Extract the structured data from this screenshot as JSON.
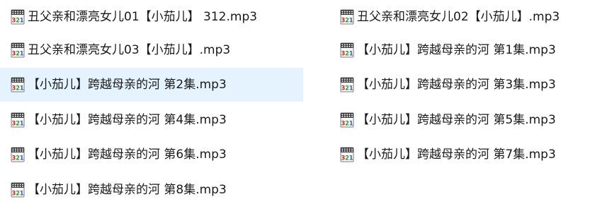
{
  "files": [
    {
      "name": "丑父亲和漂亮女儿01【小茄儿】 312.mp3",
      "icon": "media-player-321-icon",
      "selected": false
    },
    {
      "name": "丑父亲和漂亮女儿02【小茄儿】.mp3",
      "icon": "media-player-321-icon",
      "selected": false
    },
    {
      "name": "丑父亲和漂亮女儿03【小茄儿】.mp3",
      "icon": "media-player-321-icon",
      "selected": false
    },
    {
      "name": "【小茄儿】跨越母亲的河 第1集.mp3",
      "icon": "media-player-321-icon",
      "selected": false
    },
    {
      "name": "【小茄儿】跨越母亲的河 第2集.mp3",
      "icon": "media-player-321-icon",
      "selected": true
    },
    {
      "name": "【小茄儿】跨越母亲的河 第3集.mp3",
      "icon": "media-player-321-icon",
      "selected": false
    },
    {
      "name": "【小茄儿】跨越母亲的河 第4集.mp3",
      "icon": "media-player-321-icon",
      "selected": false
    },
    {
      "name": "【小茄儿】跨越母亲的河 第5集.mp3",
      "icon": "media-player-321-icon",
      "selected": false
    },
    {
      "name": "【小茄儿】跨越母亲的河 第6集.mp3",
      "icon": "media-player-321-icon",
      "selected": false
    },
    {
      "name": "【小茄儿】跨越母亲的河 第7集.mp3",
      "icon": "media-player-321-icon",
      "selected": false
    },
    {
      "name": "【小茄儿】跨越母亲的河 第8集.mp3",
      "icon": "media-player-321-icon",
      "selected": false
    }
  ],
  "icon_label": "321",
  "colors": {
    "selection": "#e5f3ff",
    "text": "#1a1a1a",
    "icon_red": "#d42a1f",
    "icon_green": "#2f9a2f",
    "icon_blue": "#2f5fbf"
  }
}
